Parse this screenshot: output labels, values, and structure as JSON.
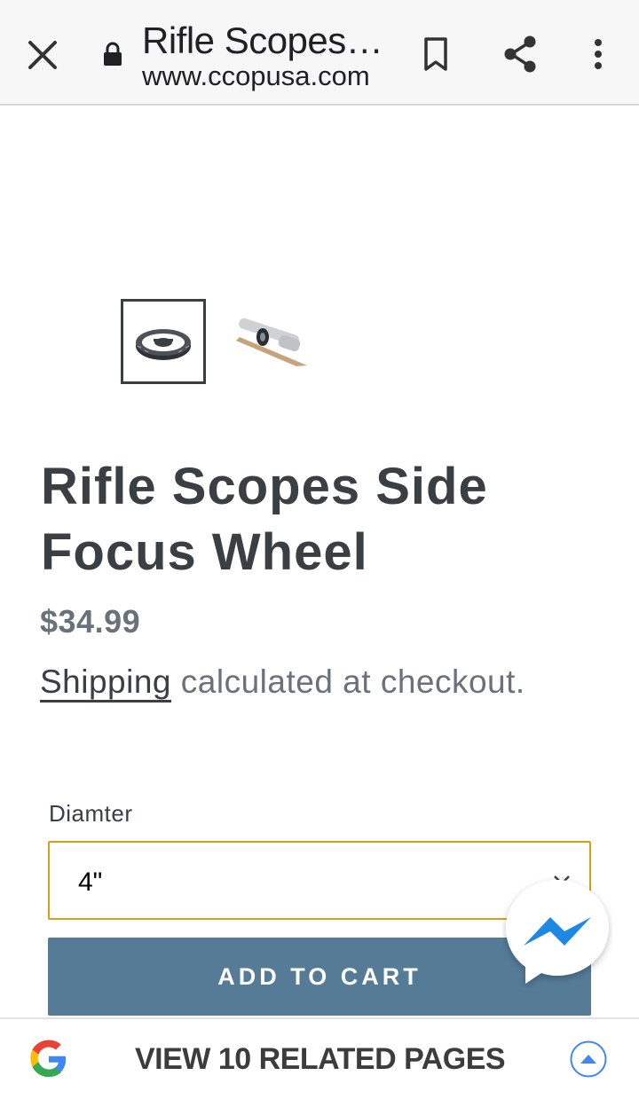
{
  "browser": {
    "title": "Rifle Scopes…",
    "url": "www.ccopusa.com"
  },
  "icons": {
    "close": "close-icon",
    "lock": "lock-icon",
    "bookmark": "bookmark-icon",
    "share": "share-icon",
    "more": "more-vert-icon",
    "messenger": "messenger-icon",
    "google": "google-icon",
    "expand": "chevron-up-icon"
  },
  "product": {
    "title": "Rifle Scopes Side Focus Wheel",
    "price": "$34.99",
    "shipping_link": "Shipping",
    "shipping_rest": " calculated at checkout.",
    "option_label": "Diamter",
    "option_value": "4\"",
    "add_to_cart": "ADD TO CART"
  },
  "related": {
    "label": "VIEW 10 RELATED PAGES"
  },
  "colors": {
    "button": "#557b97",
    "select_border": "#d4a017",
    "text": "#3a3f44",
    "price": "#69727b"
  }
}
